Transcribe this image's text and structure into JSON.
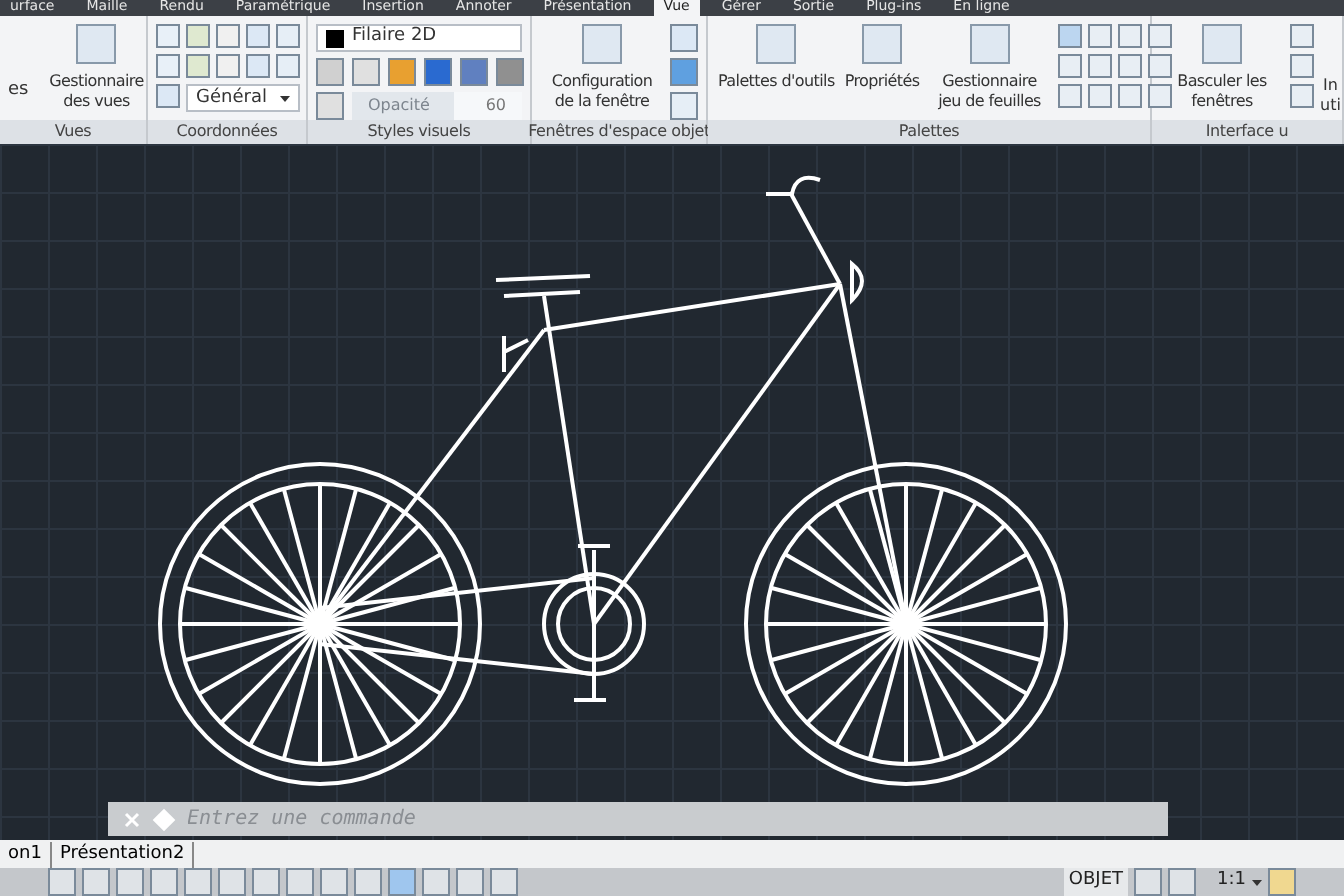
{
  "ribbon_tabs": [
    {
      "label": "urface",
      "selected": false
    },
    {
      "label": "Maille",
      "selected": false
    },
    {
      "label": "Rendu",
      "selected": false
    },
    {
      "label": "Paramétrique",
      "selected": false
    },
    {
      "label": "Insertion",
      "selected": false
    },
    {
      "label": "Annoter",
      "selected": false
    },
    {
      "label": "Présentation",
      "selected": false
    },
    {
      "label": "Vue",
      "selected": true
    },
    {
      "label": "Gérer",
      "selected": false
    },
    {
      "label": "Sortie",
      "selected": false
    },
    {
      "label": "Plug-ins",
      "selected": false
    },
    {
      "label": "En ligne",
      "selected": false
    }
  ],
  "panels": {
    "vues": {
      "title": "Vues",
      "cut_button": "es",
      "manager_button": "Gestionnaire des vues"
    },
    "coordonnees": {
      "title": "Coordonnées",
      "ucs_dropdown": "Général"
    },
    "styles": {
      "title": "Styles visuels",
      "style_dropdown": "Filaire 2D",
      "opacity_label": "Opacité",
      "opacity_value": "60",
      "level": 0.6
    },
    "fenetres": {
      "title": "Fenêtres d'espace objet",
      "config_button": "Configuration de la fenêtre"
    },
    "palettes": {
      "title": "Palettes",
      "buttons": [
        "Palettes d'outils",
        "Propriétés",
        "Gestionnaire jeu de feuilles"
      ]
    },
    "interface": {
      "title": "Interface u",
      "switch_button": "Basculer les fenêtres",
      "cut_button_line1": "In",
      "cut_button_line2": "uti"
    }
  },
  "command_line": {
    "placeholder": "Entrez une commande"
  },
  "layout_tabs": [
    {
      "label": "on1",
      "selected": false
    },
    {
      "label": "Présentation2",
      "selected": false
    }
  ],
  "status_bar": {
    "space": "OBJET",
    "scale": "1:1"
  }
}
